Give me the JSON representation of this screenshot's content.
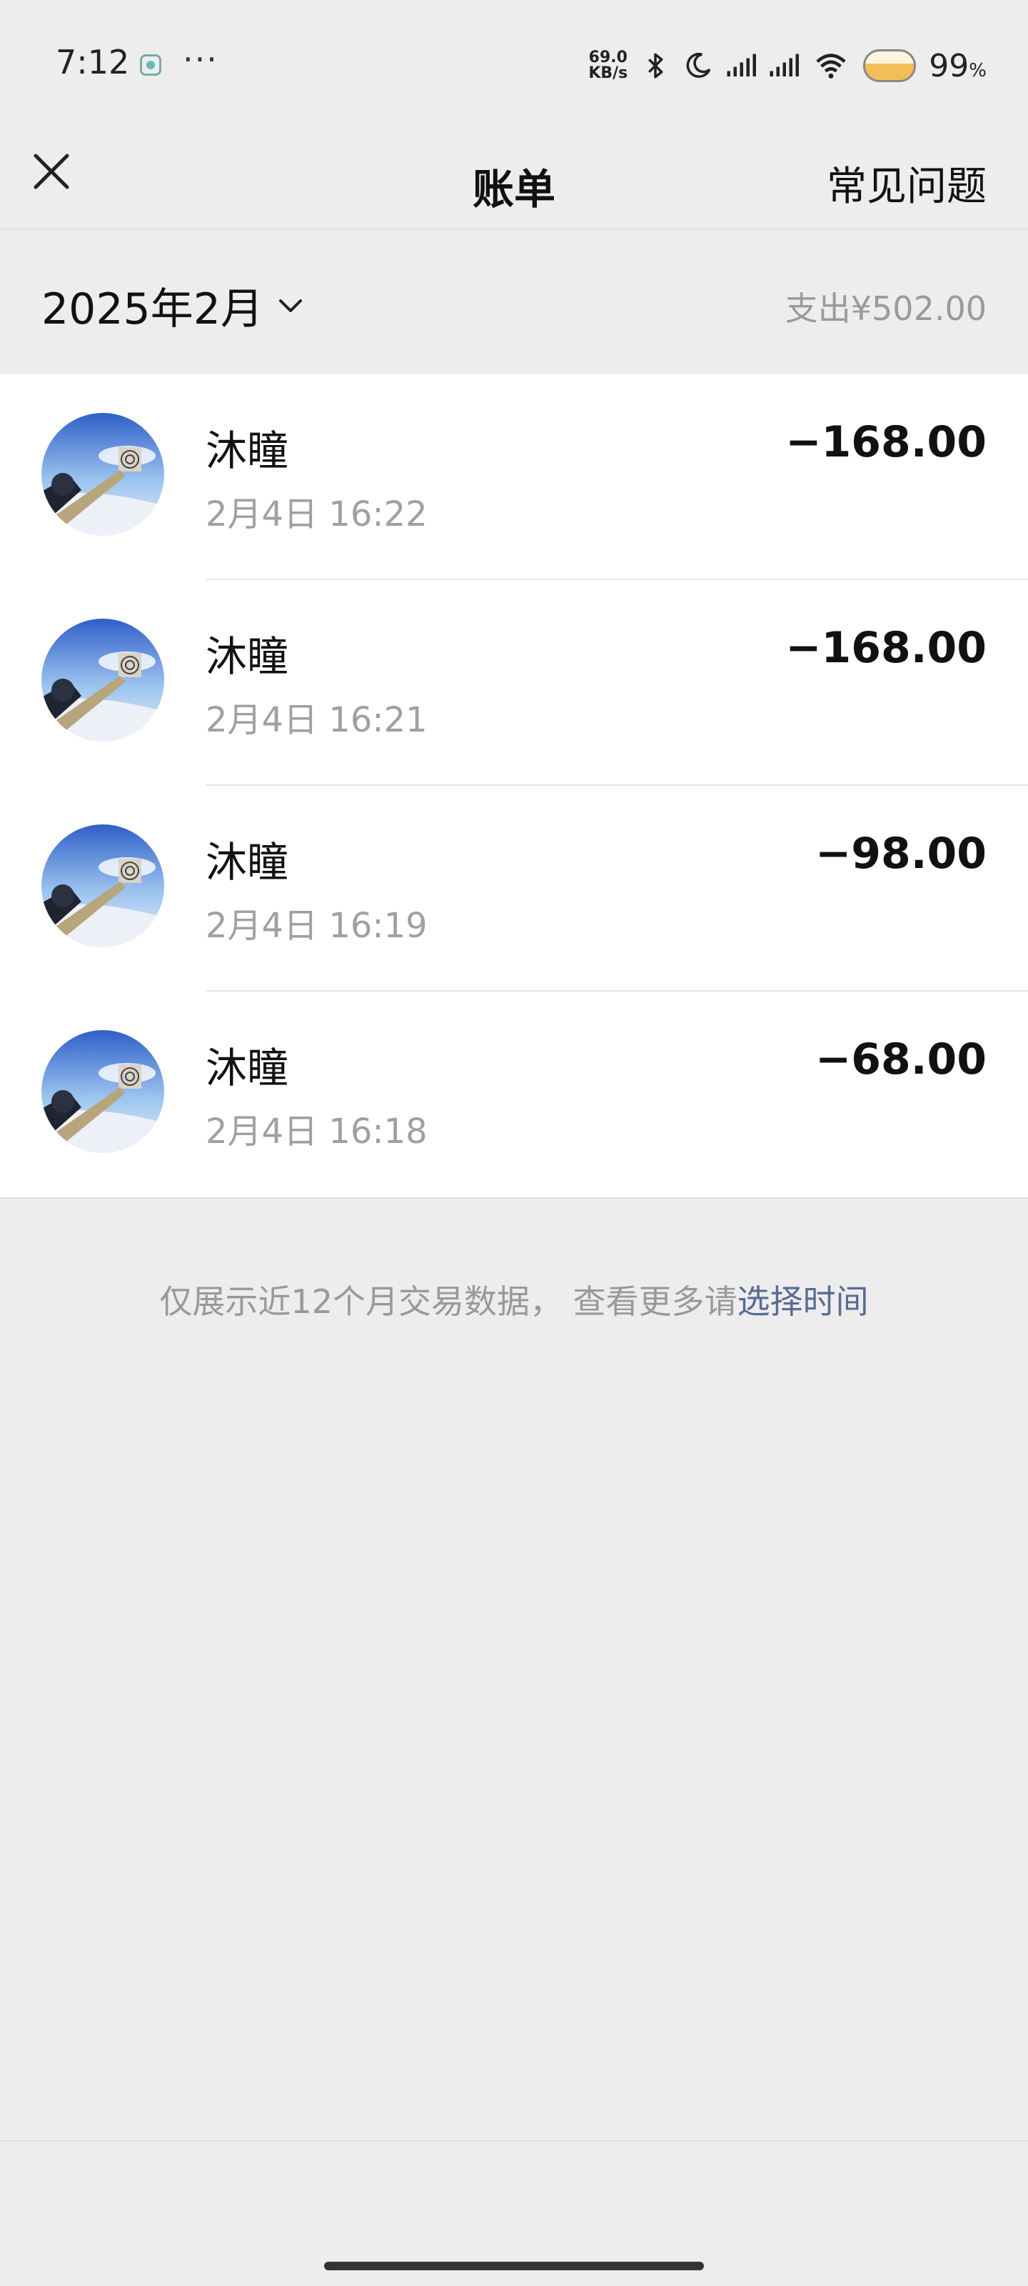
{
  "status_bar": {
    "time": "7:12",
    "more_dots": "···",
    "net_speed_value": "69.0",
    "net_speed_unit": "KB/s",
    "battery_percent": "99",
    "battery_unit": "%",
    "icons": [
      "app-notification-icon",
      "bluetooth-icon",
      "moon-icon",
      "signal-icon",
      "signal-icon",
      "wifi-icon",
      "battery-icon"
    ]
  },
  "nav": {
    "title": "账单",
    "faq_label": "常见问题",
    "close_icon": "close-icon"
  },
  "month_header": {
    "month": "2025年2月",
    "summary": "支出¥502.00"
  },
  "transactions": [
    {
      "name": "沐瞳",
      "time": "2月4日 16:22",
      "amount": "−168.00"
    },
    {
      "name": "沐瞳",
      "time": "2月4日 16:21",
      "amount": "−168.00"
    },
    {
      "name": "沐瞳",
      "time": "2月4日 16:19",
      "amount": "−98.00"
    },
    {
      "name": "沐瞳",
      "time": "2月4日 16:18",
      "amount": "−68.00"
    }
  ],
  "footer": {
    "note": "仅展示近12个月交易数据，  查看更多请",
    "link": "选择时间"
  },
  "colors": {
    "background": "#ededed",
    "card": "#ffffff",
    "link": "#576b95",
    "secondary_text": "#9a9a9a"
  }
}
